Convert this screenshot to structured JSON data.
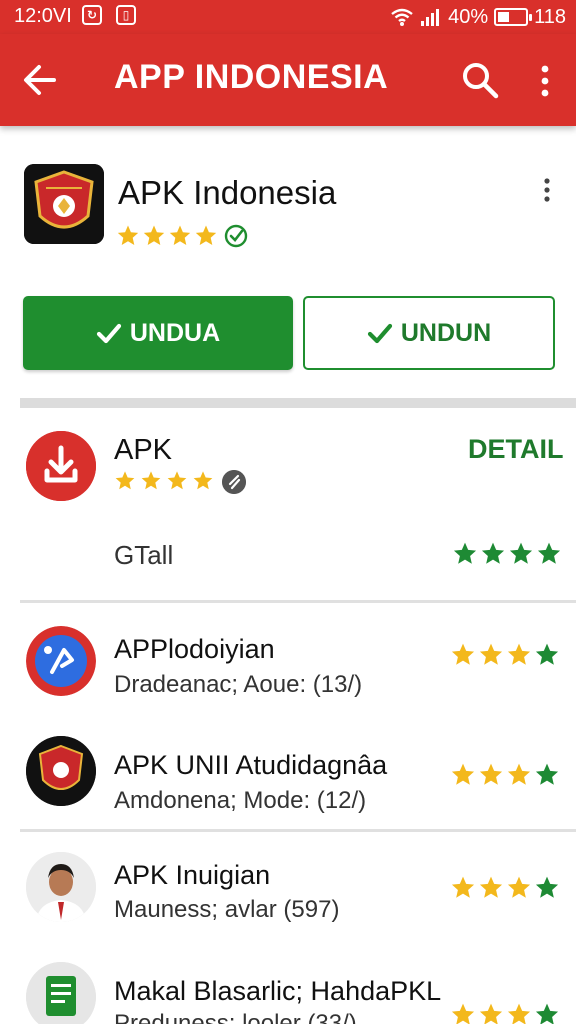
{
  "status_bar": {
    "time": "12:0VI",
    "icons": [
      "sync-icon",
      "save-icon"
    ],
    "battery_percent": "40%",
    "battery_level": 0.4,
    "extra": "118"
  },
  "app_bar": {
    "title": "APP INDONESIA",
    "back_icon": "arrow-left-icon",
    "search_icon": "search-icon",
    "menu_icon": "more-vert-icon"
  },
  "app": {
    "name": "APK Indonesia",
    "stars": 4,
    "icon": "emblem-icon",
    "badge_icon": "verified-icon"
  },
  "actions": {
    "primary_label": "UNDUA",
    "secondary_label": "UNDUN"
  },
  "featured": {
    "name": "APK",
    "detail_label": "DETAIL",
    "subtitle": "GTall",
    "icon": "download-icon",
    "rating": 4
  },
  "list": [
    {
      "name": "APPlodoiyian",
      "sub": "Dradeanac; Aoue: (13/)",
      "rating": 3.5,
      "icon": "android-app-icon"
    },
    {
      "name": "APK UNII Atudidagnâa",
      "sub": "Amdonena; Mode: (12/)",
      "rating": 3.5,
      "icon": "emblem-icon"
    },
    {
      "name": "APK Inuigian",
      "sub": "Mauness; avlar (597)",
      "rating": 4,
      "icon": "avatar-icon"
    },
    {
      "name": "Makal Blasarlic; HahdaPKL",
      "sub": "Preduness; looler (33/)",
      "rating": 3,
      "icon": "document-icon"
    }
  ],
  "colors": {
    "brand_red": "#d9302b",
    "accent_green": "#1f8e2f",
    "star_gold": "#f3b81c",
    "star_green": "#1e8a34"
  }
}
